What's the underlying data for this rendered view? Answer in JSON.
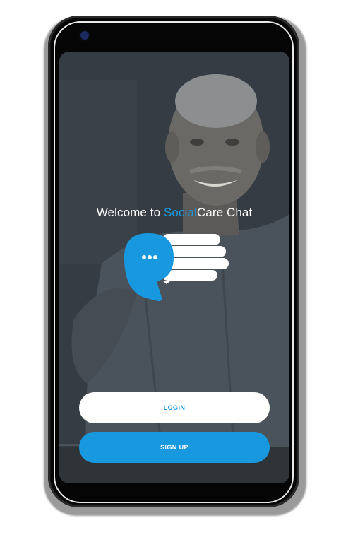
{
  "welcome": {
    "prefix": "Welcome to ",
    "brand_accent": "Social",
    "brand_rest": "Care Chat"
  },
  "buttons": {
    "login_label": "LOGIN",
    "signup_label": "SIGN UP"
  },
  "colors": {
    "accent": "#1a9be0",
    "overlay": "#3a4149",
    "button_white": "#ffffff"
  },
  "icons": [
    "speech-bubble-logo-icon",
    "hand-icon",
    "camera-icon"
  ]
}
